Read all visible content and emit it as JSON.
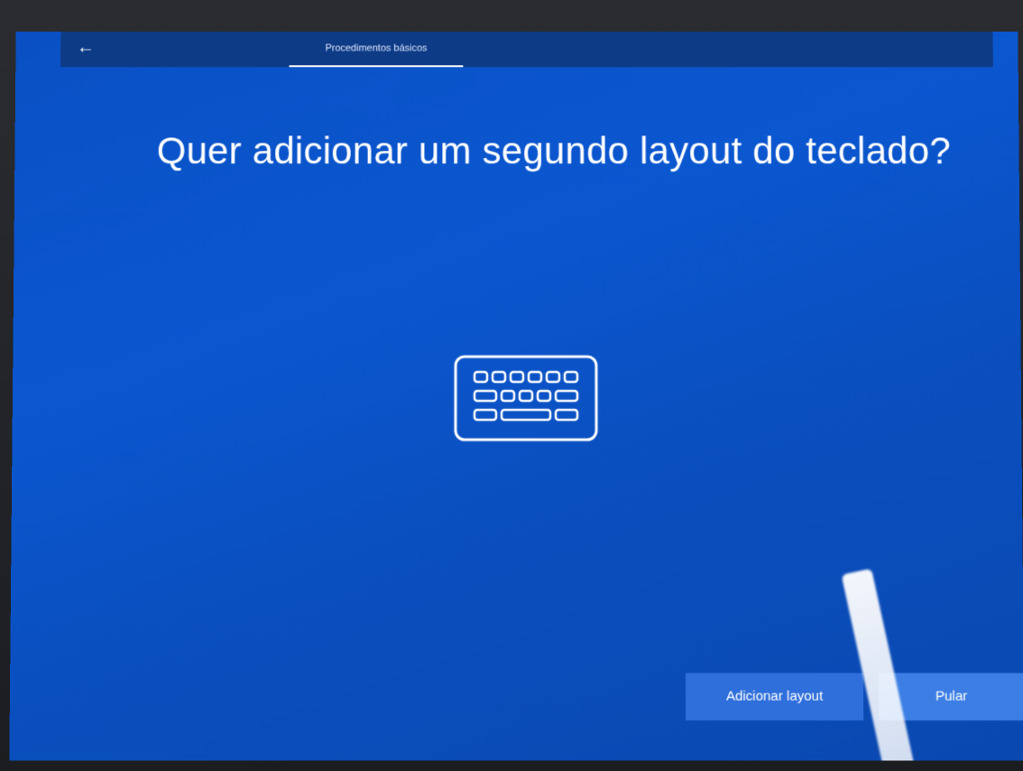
{
  "topbar": {
    "tab_label": "Procedimentos básicos"
  },
  "main": {
    "title": "Quer adicionar um segundo layout do teclado?",
    "icon": "keyboard-icon"
  },
  "actions": {
    "add_layout_label": "Adicionar layout",
    "skip_label": "Pular"
  },
  "colors": {
    "screen_blue": "#0b57d0",
    "topbar_blue": "#0e3b86",
    "button_blue": "#2f6fdb"
  }
}
